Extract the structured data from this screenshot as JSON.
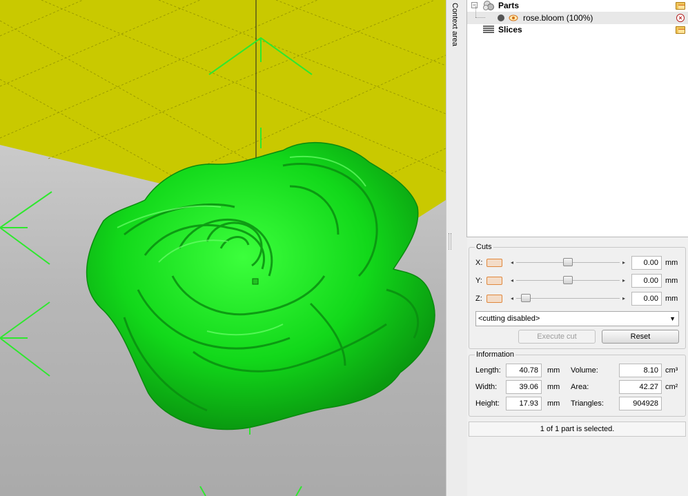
{
  "context_area": {
    "title": "Context area"
  },
  "tree": {
    "parts_label": "Parts",
    "part_item_label": "rose.bloom (100%)",
    "slices_label": "Slices",
    "expander_symbol": "−"
  },
  "cuts": {
    "title": "Cuts",
    "rows": [
      {
        "axis": "X:",
        "value": "0.00",
        "unit": "mm",
        "position": 0.5
      },
      {
        "axis": "Y:",
        "value": "0.00",
        "unit": "mm",
        "position": 0.5
      },
      {
        "axis": "Z:",
        "value": "0.00",
        "unit": "mm",
        "position": 0.0
      }
    ],
    "mode_selected": "<cutting disabled>",
    "execute_label": "Execute cut",
    "reset_label": "Reset"
  },
  "info": {
    "title": "Information",
    "length_label": "Length:",
    "length_value": "40.78",
    "length_unit": "mm",
    "width_label": "Width:",
    "width_value": "39.06",
    "width_unit": "mm",
    "height_label": "Height:",
    "height_value": "17.93",
    "height_unit": "mm",
    "volume_label": "Volume:",
    "volume_value": "8.10",
    "volume_unit": "cm³",
    "area_label": "Area:",
    "area_value": "42.27",
    "area_unit": "cm²",
    "triangles_label": "Triangles:",
    "triangles_value": "904928"
  },
  "status": {
    "text": "1 of 1 part is selected."
  },
  "colors": {
    "build_plate": "#c9c900",
    "model": "#14e01a",
    "guide": "#2ee82e",
    "accent_swatch": "#e0873c"
  }
}
